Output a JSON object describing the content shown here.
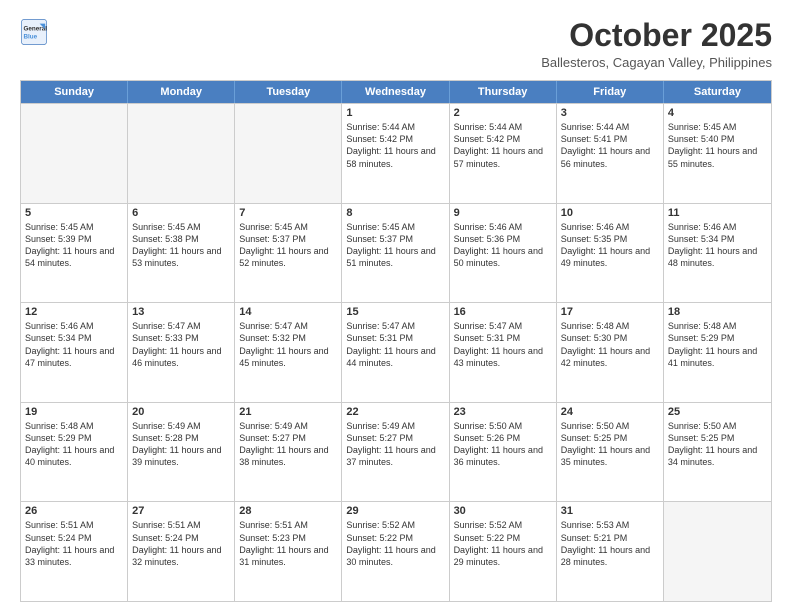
{
  "logo": {
    "line1": "General",
    "line2": "Blue"
  },
  "title": "October 2025",
  "subtitle": "Ballesteros, Cagayan Valley, Philippines",
  "days": [
    "Sunday",
    "Monday",
    "Tuesday",
    "Wednesday",
    "Thursday",
    "Friday",
    "Saturday"
  ],
  "weeks": [
    [
      {
        "day": "",
        "empty": true
      },
      {
        "day": "",
        "empty": true
      },
      {
        "day": "",
        "empty": true
      },
      {
        "day": "1",
        "sunrise": "5:44 AM",
        "sunset": "5:42 PM",
        "daylight": "11 hours and 58 minutes."
      },
      {
        "day": "2",
        "sunrise": "5:44 AM",
        "sunset": "5:42 PM",
        "daylight": "11 hours and 57 minutes."
      },
      {
        "day": "3",
        "sunrise": "5:44 AM",
        "sunset": "5:41 PM",
        "daylight": "11 hours and 56 minutes."
      },
      {
        "day": "4",
        "sunrise": "5:45 AM",
        "sunset": "5:40 PM",
        "daylight": "11 hours and 55 minutes."
      }
    ],
    [
      {
        "day": "5",
        "sunrise": "5:45 AM",
        "sunset": "5:39 PM",
        "daylight": "11 hours and 54 minutes."
      },
      {
        "day": "6",
        "sunrise": "5:45 AM",
        "sunset": "5:38 PM",
        "daylight": "11 hours and 53 minutes."
      },
      {
        "day": "7",
        "sunrise": "5:45 AM",
        "sunset": "5:37 PM",
        "daylight": "11 hours and 52 minutes."
      },
      {
        "day": "8",
        "sunrise": "5:45 AM",
        "sunset": "5:37 PM",
        "daylight": "11 hours and 51 minutes."
      },
      {
        "day": "9",
        "sunrise": "5:46 AM",
        "sunset": "5:36 PM",
        "daylight": "11 hours and 50 minutes."
      },
      {
        "day": "10",
        "sunrise": "5:46 AM",
        "sunset": "5:35 PM",
        "daylight": "11 hours and 49 minutes."
      },
      {
        "day": "11",
        "sunrise": "5:46 AM",
        "sunset": "5:34 PM",
        "daylight": "11 hours and 48 minutes."
      }
    ],
    [
      {
        "day": "12",
        "sunrise": "5:46 AM",
        "sunset": "5:34 PM",
        "daylight": "11 hours and 47 minutes."
      },
      {
        "day": "13",
        "sunrise": "5:47 AM",
        "sunset": "5:33 PM",
        "daylight": "11 hours and 46 minutes."
      },
      {
        "day": "14",
        "sunrise": "5:47 AM",
        "sunset": "5:32 PM",
        "daylight": "11 hours and 45 minutes."
      },
      {
        "day": "15",
        "sunrise": "5:47 AM",
        "sunset": "5:31 PM",
        "daylight": "11 hours and 44 minutes."
      },
      {
        "day": "16",
        "sunrise": "5:47 AM",
        "sunset": "5:31 PM",
        "daylight": "11 hours and 43 minutes."
      },
      {
        "day": "17",
        "sunrise": "5:48 AM",
        "sunset": "5:30 PM",
        "daylight": "11 hours and 42 minutes."
      },
      {
        "day": "18",
        "sunrise": "5:48 AM",
        "sunset": "5:29 PM",
        "daylight": "11 hours and 41 minutes."
      }
    ],
    [
      {
        "day": "19",
        "sunrise": "5:48 AM",
        "sunset": "5:29 PM",
        "daylight": "11 hours and 40 minutes."
      },
      {
        "day": "20",
        "sunrise": "5:49 AM",
        "sunset": "5:28 PM",
        "daylight": "11 hours and 39 minutes."
      },
      {
        "day": "21",
        "sunrise": "5:49 AM",
        "sunset": "5:27 PM",
        "daylight": "11 hours and 38 minutes."
      },
      {
        "day": "22",
        "sunrise": "5:49 AM",
        "sunset": "5:27 PM",
        "daylight": "11 hours and 37 minutes."
      },
      {
        "day": "23",
        "sunrise": "5:50 AM",
        "sunset": "5:26 PM",
        "daylight": "11 hours and 36 minutes."
      },
      {
        "day": "24",
        "sunrise": "5:50 AM",
        "sunset": "5:25 PM",
        "daylight": "11 hours and 35 minutes."
      },
      {
        "day": "25",
        "sunrise": "5:50 AM",
        "sunset": "5:25 PM",
        "daylight": "11 hours and 34 minutes."
      }
    ],
    [
      {
        "day": "26",
        "sunrise": "5:51 AM",
        "sunset": "5:24 PM",
        "daylight": "11 hours and 33 minutes."
      },
      {
        "day": "27",
        "sunrise": "5:51 AM",
        "sunset": "5:24 PM",
        "daylight": "11 hours and 32 minutes."
      },
      {
        "day": "28",
        "sunrise": "5:51 AM",
        "sunset": "5:23 PM",
        "daylight": "11 hours and 31 minutes."
      },
      {
        "day": "29",
        "sunrise": "5:52 AM",
        "sunset": "5:22 PM",
        "daylight": "11 hours and 30 minutes."
      },
      {
        "day": "30",
        "sunrise": "5:52 AM",
        "sunset": "5:22 PM",
        "daylight": "11 hours and 29 minutes."
      },
      {
        "day": "31",
        "sunrise": "5:53 AM",
        "sunset": "5:21 PM",
        "daylight": "11 hours and 28 minutes."
      },
      {
        "day": "",
        "empty": true
      }
    ]
  ],
  "labels": {
    "sunrise": "Sunrise:",
    "sunset": "Sunset:",
    "daylight": "Daylight:"
  }
}
